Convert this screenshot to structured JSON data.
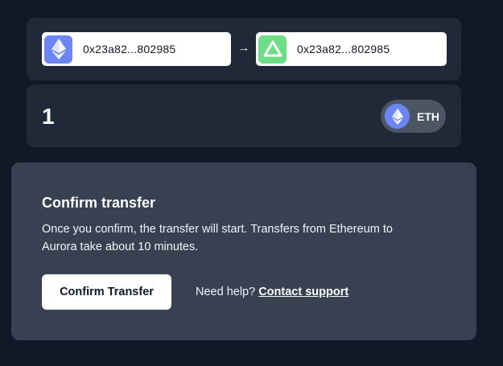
{
  "transfer": {
    "from": {
      "network_icon": "ethereum-icon",
      "address": "0x23a82...802985"
    },
    "arrow": "→",
    "to": {
      "network_icon": "aurora-icon",
      "address": "0x23a82...802985"
    }
  },
  "amount": {
    "value": "1",
    "token": {
      "symbol": "ETH",
      "icon": "ethereum-icon"
    }
  },
  "confirm": {
    "title": "Confirm transfer",
    "description": "Once you confirm, the transfer will start. Transfers from Ethereum to Aurora take about 10 minutes.",
    "button_label": "Confirm Transfer",
    "help_text": "Need help?",
    "help_link": "Contact support"
  },
  "colors": {
    "background": "#111827",
    "card": "#1f2937",
    "panel": "#374151",
    "ethereum": "#6b86f4",
    "aurora": "#6fdc86"
  }
}
